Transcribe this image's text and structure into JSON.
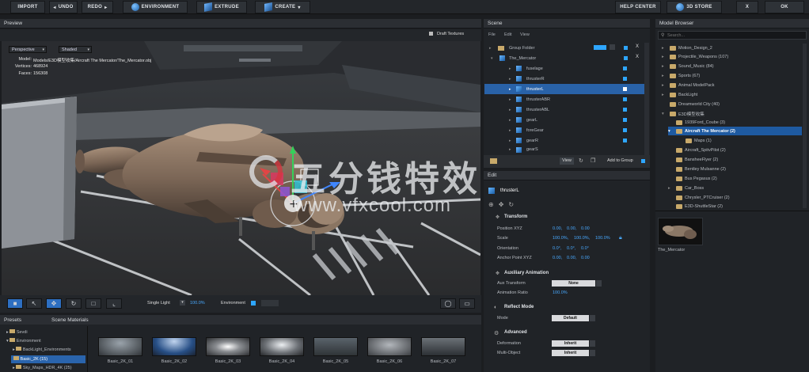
{
  "toolbar": {
    "import": "IMPORT",
    "undo": "UNDO",
    "redo": "REDO",
    "environment": "ENVIRONMENT",
    "extrude": "EXTRUDE",
    "create": "CREATE",
    "help_center": "HELP CENTER",
    "store": "3D STORE",
    "close": "X",
    "ok": "OK"
  },
  "preview": {
    "title": "Preview",
    "draft_textures": "Draft Textures",
    "camera_mode": "Perspective",
    "shading_mode": "Shaded",
    "model_label": "Model:",
    "model_path": "Models/E3D模型收集/Aircraft The Mercator/The_Mercator.obj",
    "vertices_label": "Vertices:",
    "vertices": "468924",
    "faces_label": "Faces:",
    "faces": "156308",
    "light_mode": "Single Light",
    "light_percent": "100.0%",
    "environment_label": "Environment"
  },
  "scene": {
    "title": "Scene",
    "menu": [
      "File",
      "Edit",
      "View"
    ],
    "group_folder": "Group Folder",
    "root": "The_Mercator",
    "items": [
      "fuselage",
      "thrusterR",
      "thrusterL",
      "thrusterABR",
      "thrusterABL",
      "gearL",
      "foreGear",
      "gearR",
      "gearS"
    ],
    "view_label": "View",
    "add_to_group": "Add to Group"
  },
  "edit": {
    "title": "Edit",
    "object_name": "thrusterL",
    "transform": "Transform",
    "position_label": "Position XYZ",
    "position": [
      "0.00,",
      "0.00,",
      "0.00"
    ],
    "scale_label": "Scale",
    "scale": [
      "100.0%,",
      "100.0%,",
      "100.0%"
    ],
    "orientation_label": "Orientation",
    "orientation": [
      "0.0°,",
      "0.0°,",
      "0.0°"
    ],
    "anchor_label": "Anchor Point XYZ",
    "anchor": [
      "0.00,",
      "0.00,",
      "0.00"
    ],
    "aux_animation": "Auxiliary Animation",
    "aux_transform_label": "Aux Transform",
    "aux_transform": "None",
    "animation_ratio_label": "Animation Ratio",
    "animation_ratio": "100.0%",
    "reflect_mode": "Reflect Mode",
    "mode_label": "Mode",
    "mode": "Default",
    "advanced": "Advanced",
    "deformation_label": "Deformation",
    "deformation": "Inherit",
    "multi_object_label": "Multi-Object",
    "multi_object": "Inherit"
  },
  "model_browser": {
    "title": "Model Browser",
    "search_placeholder": "Search...",
    "items": [
      "Motion_Design_2",
      "Projectile_Weapons (107)",
      "Sound_Music (84)",
      "Sports (67)",
      "Animal ModelPack",
      "BackLight",
      "Dreamworld City (40)",
      "E3D模型收集",
      "1939Ford_Coube (3)",
      "Aircraft The Mercator (2)",
      "Maps (1)",
      "Aircraft_SpitvPilot (2)",
      "BansheeFlyer (2)",
      "Bentley Mulsanne (2)",
      "Bus Pegasus (2)",
      "Car_Boss",
      "Chrysler_PTCruiser (2)",
      "E3D-ShuttleStar (2)"
    ],
    "thumb_label": "The_Mercator"
  },
  "presets": {
    "tab_presets": "Presets",
    "tab_materials": "Scene Materials",
    "tree": [
      "Sevdi",
      "Environment",
      "BackLight_Environments",
      "Basic_2K (15)",
      "Sky_Maps_HDR_4K (25)"
    ],
    "thumbs": [
      "Basic_2K_01",
      "Basic_2K_02",
      "Basic_2K_03",
      "Basic_2K_04",
      "Basic_2K_05",
      "Basic_2K_06",
      "Basic_2K_07"
    ]
  },
  "watermark": {
    "brand": "五分钱特效",
    "url": "www.vfxcool.com"
  }
}
